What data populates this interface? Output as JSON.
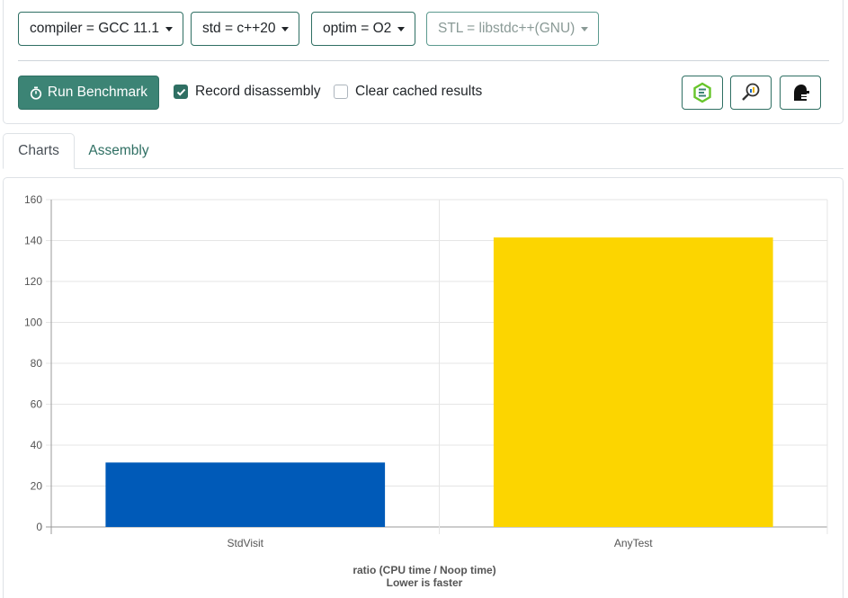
{
  "toolbar": {
    "compiler": "compiler = GCC 11.1",
    "std": "std = c++20",
    "optim": "optim = O2",
    "stl": "STL = libstdc++(GNU)",
    "run_label": "Run Benchmark",
    "record_label": "Record disassembly",
    "record_checked": true,
    "clear_label": "Clear cached results",
    "clear_checked": false
  },
  "tabs": [
    {
      "label": "Charts",
      "active": true
    },
    {
      "label": "Assembly",
      "active": false
    }
  ],
  "colors": {
    "accent": "#3c8475",
    "bar_stdvisit": "#005ab8",
    "bar_anytest": "#fcd500"
  },
  "chart_data": {
    "type": "bar",
    "categories": [
      "StdVisit",
      "AnyTest"
    ],
    "values": [
      31.5,
      141.5
    ],
    "bar_colors": [
      "#005ab8",
      "#fcd500"
    ],
    "ylim": [
      0,
      160
    ],
    "yticks": [
      0,
      20,
      40,
      60,
      80,
      100,
      120,
      140,
      160
    ],
    "xlabel_line1": "ratio (CPU time / Noop time)",
    "xlabel_line2": "Lower is faster",
    "grid": true
  }
}
